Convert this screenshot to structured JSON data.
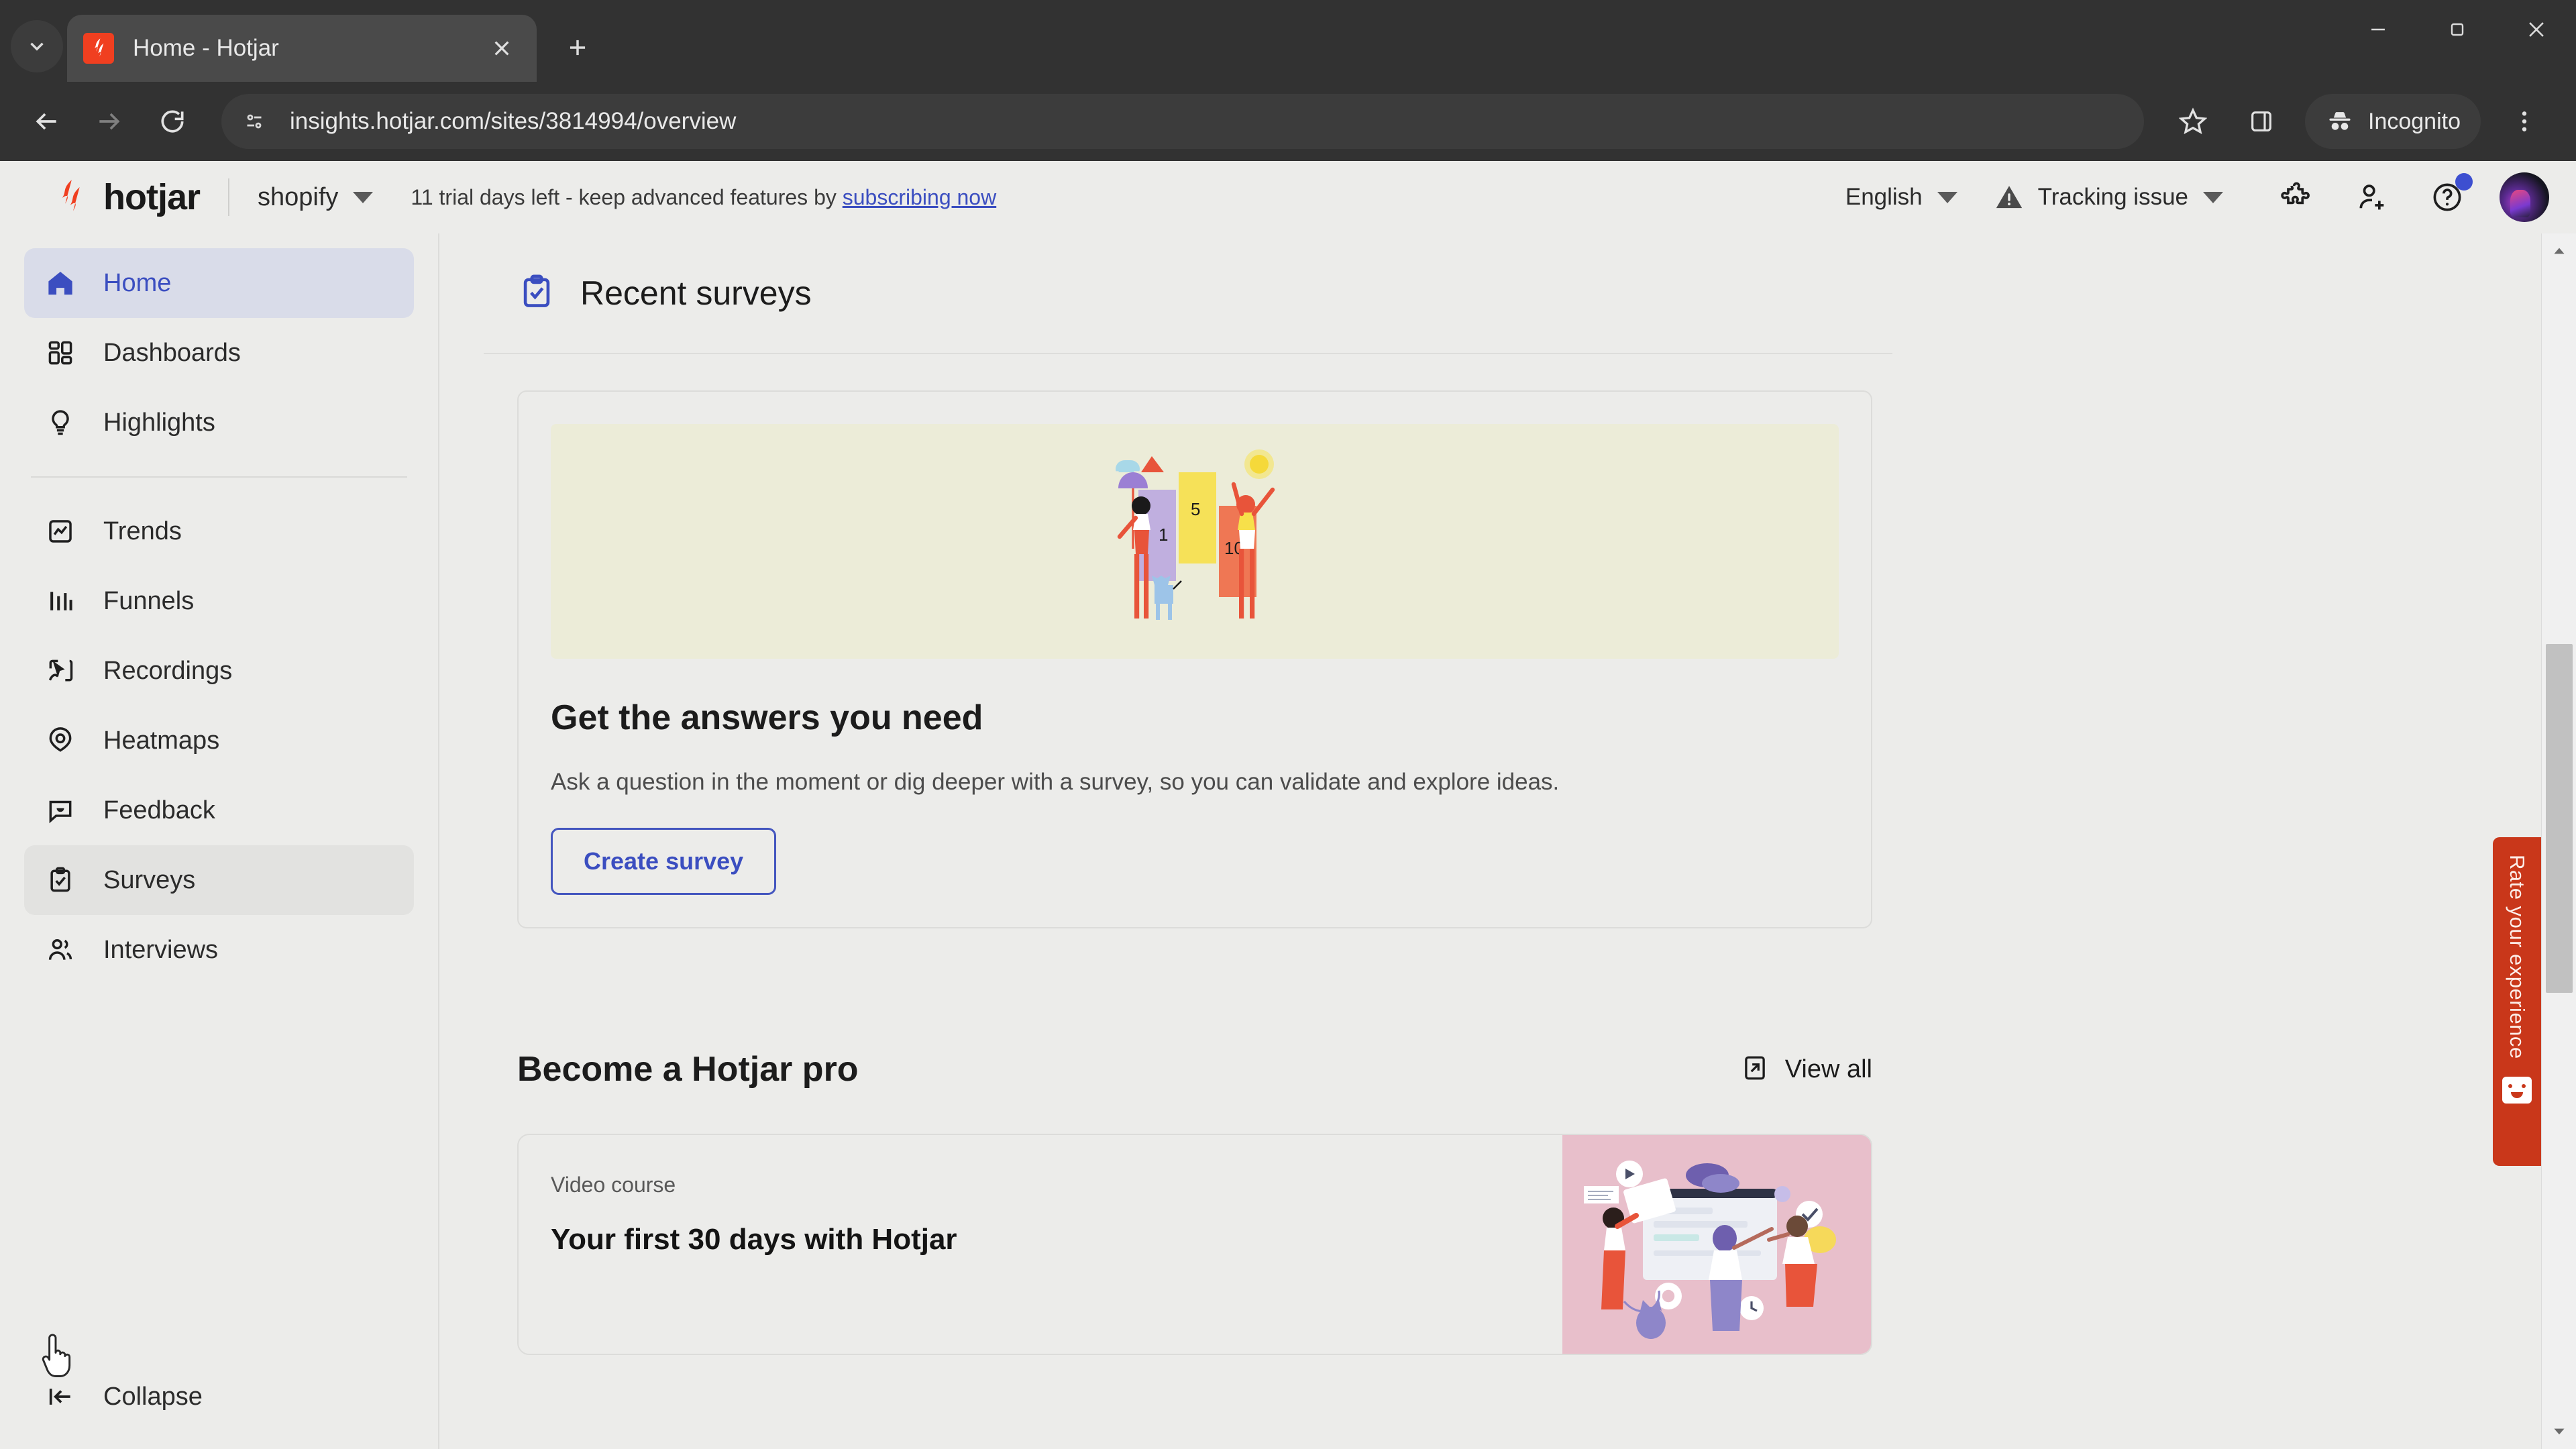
{
  "browser": {
    "tab": {
      "title": "Home - Hotjar",
      "favicon": "hotjar-favicon"
    },
    "tab_list_icon": "chevron-down-icon",
    "close_icon": "close-icon",
    "new_tab_icon": "plus-icon",
    "window_controls": {
      "minimize": "minimize-icon",
      "maximize": "maximize-icon",
      "close": "close-icon"
    },
    "nav": {
      "back": "back-arrow-icon",
      "forward": "forward-arrow-icon",
      "reload": "reload-icon"
    },
    "omnibox": {
      "url": "insights.hotjar.com/sites/3814994/overview",
      "site_info_icon": "page-info-icon"
    },
    "actions": {
      "bookmark_icon": "star-icon",
      "side_panel_icon": "side-panel-icon",
      "incognito_label": "Incognito",
      "incognito_icon": "incognito-hat-icon",
      "menu_icon": "three-dot-menu-icon"
    }
  },
  "app_header": {
    "logo_text": "hotjar",
    "site_name": "shopify",
    "trial_text": "11 trial days left - keep advanced features by ",
    "trial_link": "subscribing now",
    "language": "English",
    "tracking_status": "Tracking issue",
    "icons": {
      "warning": "warning-triangle-icon",
      "integrations": "puzzle-piece-icon",
      "invite_user": "add-user-icon",
      "help": "question-mark-circle-icon",
      "avatar": "user-avatar"
    }
  },
  "sidebar": {
    "items": [
      {
        "label": "Home",
        "icon": "home-icon",
        "state": "active"
      },
      {
        "label": "Dashboards",
        "icon": "dashboards-grid-icon",
        "state": "default"
      },
      {
        "label": "Highlights",
        "icon": "lightbulb-icon",
        "state": "default"
      },
      {
        "label": "Trends",
        "icon": "trends-chart-icon",
        "state": "default"
      },
      {
        "label": "Funnels",
        "icon": "funnels-bars-icon",
        "state": "default"
      },
      {
        "label": "Recordings",
        "icon": "recordings-cursor-icon",
        "state": "default"
      },
      {
        "label": "Heatmaps",
        "icon": "heatmap-pin-icon",
        "state": "default"
      },
      {
        "label": "Feedback",
        "icon": "feedback-bubble-icon",
        "state": "default"
      },
      {
        "label": "Surveys",
        "icon": "surveys-clipboard-icon",
        "state": "hovered"
      },
      {
        "label": "Interviews",
        "icon": "interviews-people-icon",
        "state": "default"
      }
    ],
    "collapse": {
      "label": "Collapse",
      "icon": "collapse-left-icon"
    }
  },
  "main": {
    "recent_surveys": {
      "heading": "Recent surveys",
      "icon": "surveys-clipboard-icon",
      "hero_illustration": "survey-rating-illustration",
      "hero_numbers": [
        "1",
        "5",
        "10"
      ],
      "card_title": "Get the answers you need",
      "card_body": "Ask a question in the moment or dig deeper with a survey, so you can validate and explore ideas.",
      "cta_label": "Create survey"
    },
    "become_pro": {
      "heading": "Become a Hotjar pro",
      "view_all_label": "View all",
      "view_all_icon": "external-link-icon",
      "cards": [
        {
          "kicker": "Video course",
          "title": "Your first 30 days with Hotjar",
          "art": "team-collaboration-illustration"
        }
      ]
    }
  },
  "widgets": {
    "rate_experience": {
      "label": "Rate your experience",
      "icon": "smiley-face-icon"
    }
  },
  "scrollbar": {
    "up_arrow": "scroll-up-arrow-icon",
    "down_arrow": "scroll-down-arrow-icon",
    "thumb": "scroll-thumb"
  },
  "colors": {
    "brand_red": "#f03f20",
    "accent_blue": "#3b4ec0",
    "page_bg": "#ececea",
    "chrome_bg": "#323232",
    "rate_tab_red": "#c9371a",
    "hero_bg": "#ececd8",
    "course_art_bg": "#e8bfcb"
  }
}
